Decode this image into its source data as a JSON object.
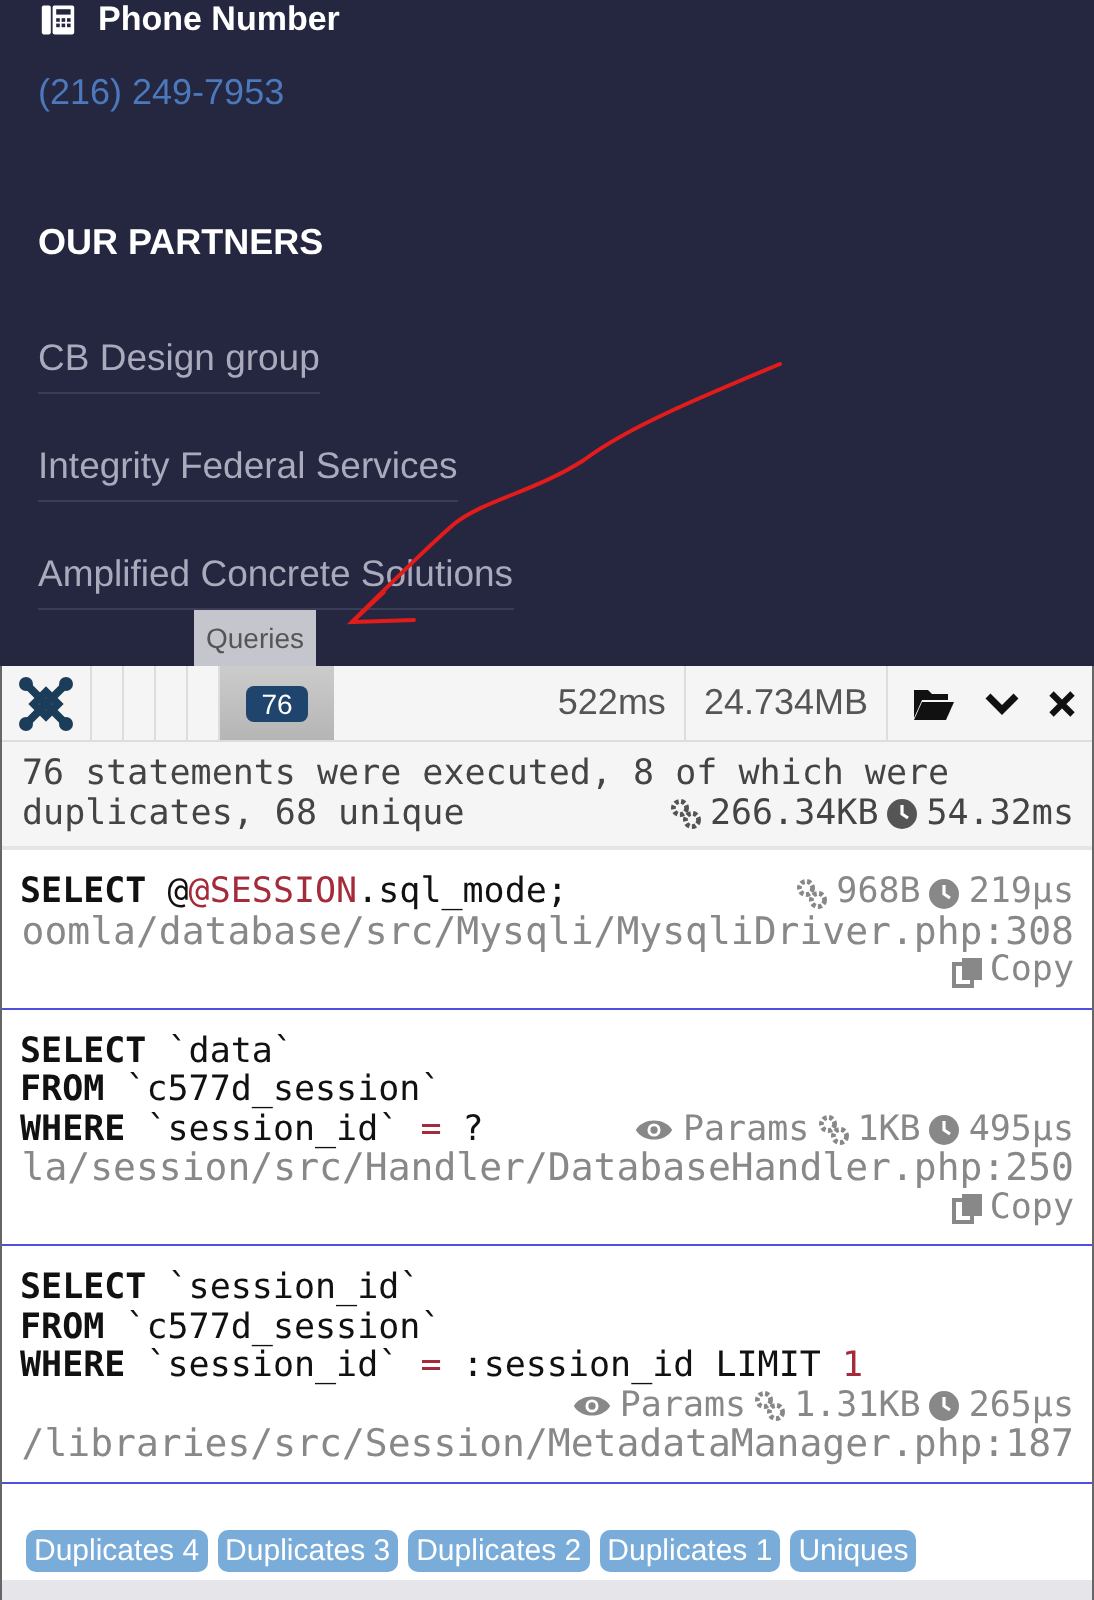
{
  "contact": {
    "label": "Phone Number",
    "phone": "(216) 249-7953"
  },
  "partners": {
    "heading": "OUR PARTNERS",
    "items": [
      "CB Design group",
      "Integrity Federal Services",
      "Amplified Concrete Solutions"
    ]
  },
  "tooltip": "Queries",
  "debugbar": {
    "tabs": [
      {
        "badge": "76",
        "selected": true
      }
    ],
    "time": "522ms",
    "memory": "24.734MB",
    "summary_lines": [
      "76 statements were executed, 8 of which were",
      "duplicates, 68 unique"
    ],
    "summary_memory": "266.34KB",
    "summary_time": "54.32ms",
    "queries": [
      {
        "lines": [
          [
            {
              "kind": "kw",
              "text": "SELECT"
            },
            {
              "kind": "plain",
              "text": " @"
            },
            {
              "kind": "hl",
              "text": "@SESSION"
            },
            {
              "kind": "plain",
              "text": ".sql_mode;"
            }
          ]
        ],
        "params": false,
        "memory": "968B",
        "time": "219µs",
        "source": "oomla/database/src/Mysqli/MysqliDriver.php:308",
        "copy": "Copy"
      },
      {
        "lines": [
          [
            {
              "kind": "kw",
              "text": "SELECT"
            },
            {
              "kind": "plain",
              "text": " `data`"
            }
          ],
          [
            {
              "kind": "kw",
              "text": "FROM"
            },
            {
              "kind": "plain",
              "text": " `c577d_session`"
            }
          ],
          [
            {
              "kind": "kw",
              "text": "WHERE"
            },
            {
              "kind": "plain",
              "text": " `session_id` "
            },
            {
              "kind": "hl",
              "text": "="
            },
            {
              "kind": "plain",
              "text": " ?"
            }
          ]
        ],
        "params": true,
        "params_label": "Params",
        "memory": "1KB",
        "time": "495µs",
        "source": "la/session/src/Handler/DatabaseHandler.php:250",
        "copy": "Copy"
      },
      {
        "lines": [
          [
            {
              "kind": "kw",
              "text": "SELECT"
            },
            {
              "kind": "plain",
              "text": " `session_id`"
            }
          ],
          [
            {
              "kind": "kw",
              "text": "FROM"
            },
            {
              "kind": "plain",
              "text": " `c577d_session`"
            }
          ],
          [
            {
              "kind": "kw",
              "text": "WHERE"
            },
            {
              "kind": "plain",
              "text": " `session_id` "
            },
            {
              "kind": "hl",
              "text": "="
            },
            {
              "kind": "plain",
              "text": " :session_id LIMIT "
            },
            {
              "kind": "hl",
              "text": "1"
            }
          ]
        ],
        "params": true,
        "params_label": "Params",
        "memory": "1.31KB",
        "time": "265µs",
        "source": "/libraries/src/Session/MetadataManager.php:187"
      }
    ],
    "filters": [
      "Duplicates 4",
      "Duplicates 3",
      "Duplicates 2",
      "Duplicates 1",
      "Uniques"
    ]
  }
}
